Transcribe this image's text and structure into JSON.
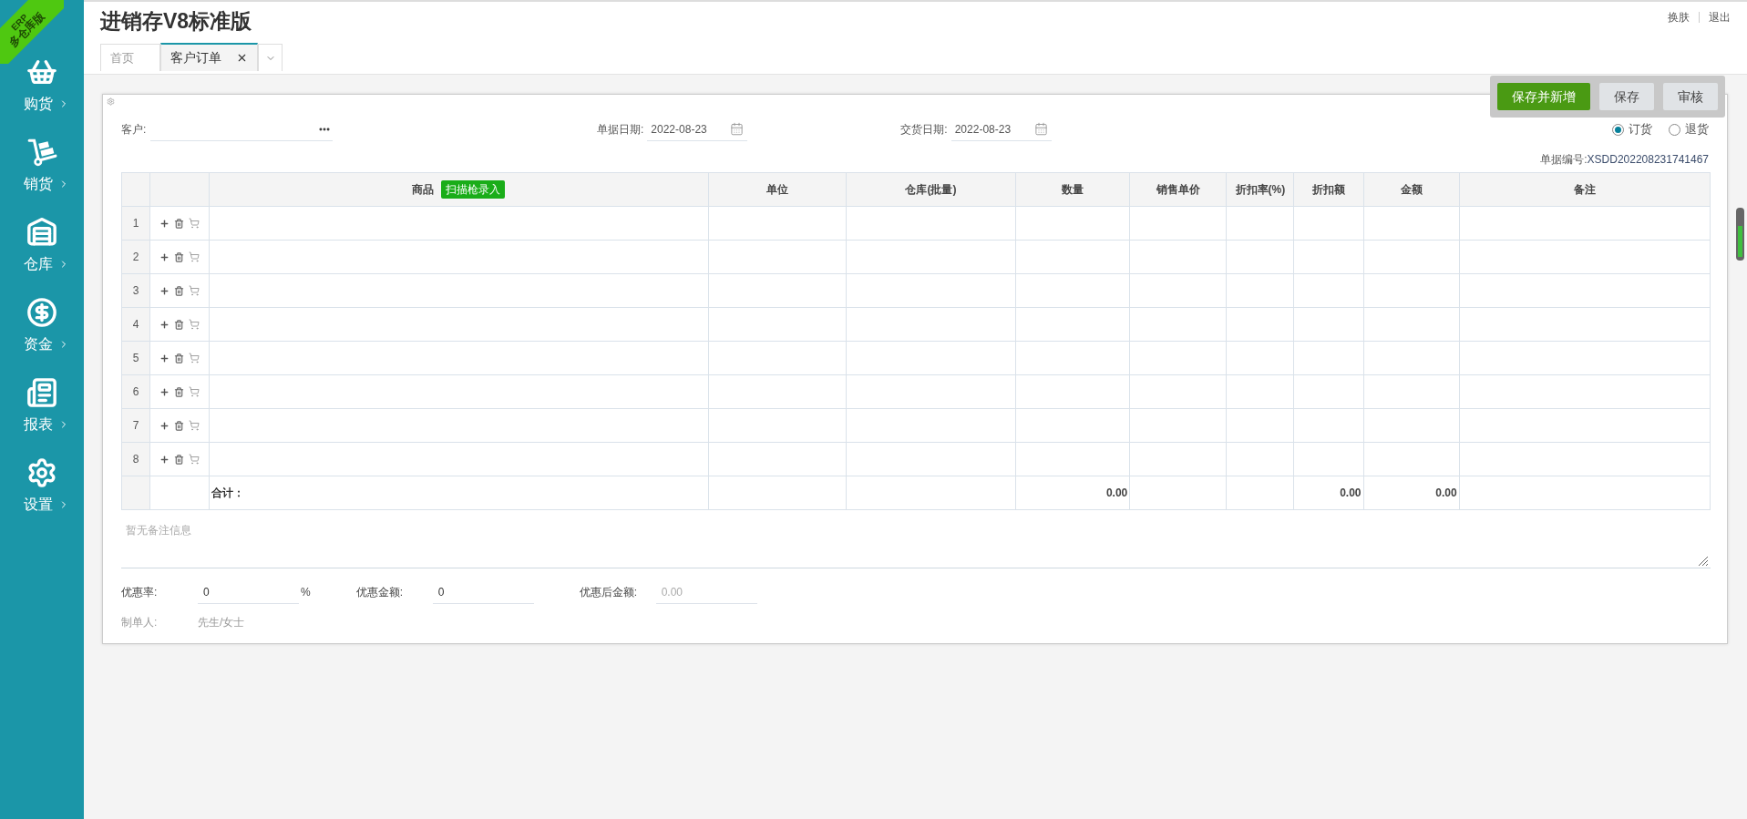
{
  "ribbon": {
    "top": "ERP",
    "bottom": "多仓库版"
  },
  "sidebar": {
    "items": [
      {
        "label": "购货"
      },
      {
        "label": "销货"
      },
      {
        "label": "仓库"
      },
      {
        "label": "资金"
      },
      {
        "label": "报表"
      },
      {
        "label": "设置"
      }
    ]
  },
  "header": {
    "title": "进销存V8标准版",
    "links": [
      "换肤",
      "退出"
    ]
  },
  "tabs": [
    {
      "label": "首页",
      "selected": false,
      "closable": false
    },
    {
      "label": "客户订单",
      "selected": true,
      "closable": true
    }
  ],
  "toolbar": {
    "buttons": [
      {
        "label": "保存并新增",
        "kind": "primary"
      },
      {
        "label": "保存",
        "kind": "default"
      },
      {
        "label": "审核",
        "kind": "default"
      }
    ]
  },
  "form": {
    "customer_label": "客户:",
    "bill_date": {
      "label": "单据日期:",
      "value": "2022-08-23"
    },
    "delivery_date": {
      "label": "交货日期:",
      "value": "2022-08-23"
    },
    "order_types": [
      {
        "label": "订货",
        "selected": true
      },
      {
        "label": "退货",
        "selected": false
      }
    ],
    "bill_no": {
      "label": "单据编号:",
      "value": "XSDD202208231741467"
    }
  },
  "table": {
    "columns": [
      {
        "label": "商品",
        "badge": "扫描枪录入"
      },
      {
        "label": "单位"
      },
      {
        "label": "仓库(批量)"
      },
      {
        "label": "数量"
      },
      {
        "label": "销售单价"
      },
      {
        "label": "折扣率(%)"
      },
      {
        "label": "折扣额"
      },
      {
        "label": "金额"
      },
      {
        "label": "备注"
      }
    ],
    "rows": [
      "1",
      "2",
      "3",
      "4",
      "5",
      "6",
      "7",
      "8"
    ],
    "total": {
      "label": "合计：",
      "quantity": "0.00",
      "discount_amount": "0.00",
      "amount": "0.00"
    }
  },
  "remark": {
    "placeholder": "暂无备注信息"
  },
  "discount_fields": [
    {
      "label": "优惠率:",
      "value": "0",
      "unit": "%",
      "disabled": false
    },
    {
      "label": "优惠金额:",
      "value": "0",
      "disabled": false
    },
    {
      "label": "优惠后金额:",
      "value": "0.00",
      "disabled": true
    }
  ],
  "maker": {
    "label": "制单人:",
    "value": "先生/女士"
  }
}
